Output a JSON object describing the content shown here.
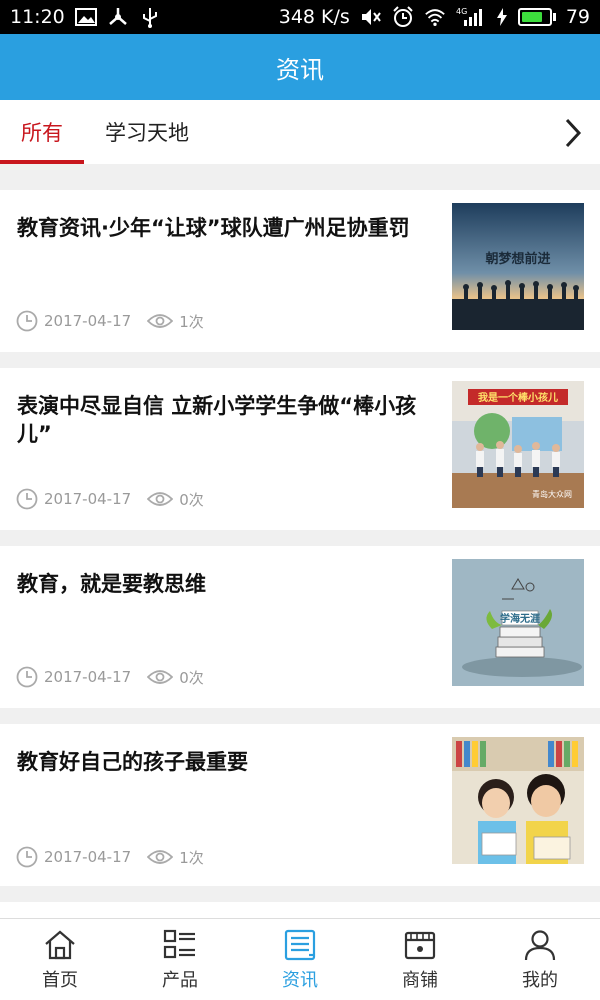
{
  "status_bar": {
    "time": "11:20",
    "net_speed": "348 K/s",
    "signal_label": "4G",
    "battery_level": "79"
  },
  "header": {
    "title": "资讯"
  },
  "tabs": [
    {
      "label": "所有",
      "active": true
    },
    {
      "label": "学习天地",
      "active": false
    }
  ],
  "news": [
    {
      "title": "教育资讯·少年“让球”球队遭广州足协重罚",
      "date": "2017-04-17",
      "views": "1次",
      "thumb_caption": "朝梦想前进"
    },
    {
      "title": "表演中尽显自信 立新小学学生争做“棒小孩儿”",
      "date": "2017-04-17",
      "views": "0次",
      "thumb_caption": "我是一个棒小孩儿",
      "thumb_credit": "青岛大众网"
    },
    {
      "title": "教育，就是要教思维",
      "date": "2017-04-17",
      "views": "0次",
      "thumb_caption": "学海无涯"
    },
    {
      "title": "教育好自己的孩子最重要",
      "date": "2017-04-17",
      "views": "1次"
    }
  ],
  "bottom_nav": [
    {
      "label": "首页",
      "icon": "home-icon"
    },
    {
      "label": "产品",
      "icon": "product-list-icon"
    },
    {
      "label": "资讯",
      "icon": "news-icon",
      "active": true
    },
    {
      "label": "商铺",
      "icon": "store-icon"
    },
    {
      "label": "我的",
      "icon": "user-icon"
    }
  ],
  "colors": {
    "accent": "#2a9fe0",
    "tab_active": "#c8161d",
    "battery": "#3ddc3d"
  }
}
